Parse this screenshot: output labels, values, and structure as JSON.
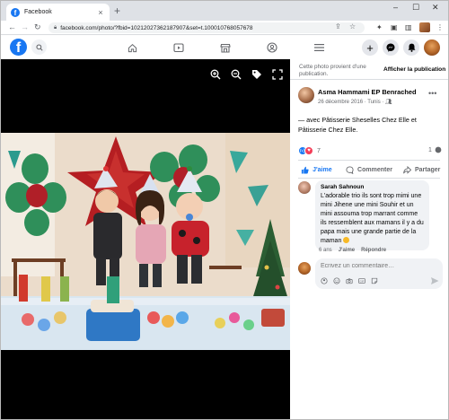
{
  "browser": {
    "tab_title": "Facebook",
    "tab_close": "×",
    "new_tab": "+",
    "url_host": "facebook.com",
    "url_path": "/photo/?fbid=10212027362187907&set=t.100010768057678",
    "window_controls": [
      "–",
      "☐",
      "✕"
    ]
  },
  "facebook_nav": {
    "logo": "f",
    "icons": [
      "home-icon",
      "watch-icon",
      "marketplace-icon",
      "groups-icon",
      "menu-icon"
    ],
    "right_icons": [
      "create-icon",
      "messenger-icon",
      "notifications-icon",
      "account-icon"
    ]
  },
  "viewer": {
    "tools": [
      "zoom-in-icon",
      "zoom-out-icon",
      "tag-icon",
      "fullscreen-icon"
    ],
    "photo_description_colors": {
      "balloon_green": "#2f8f5a",
      "star_red": "#b51e22"
    }
  },
  "panel": {
    "notice": [
      "Cette photo provient d'une",
      "publication."
    ],
    "notice_link": "Afficher la publication",
    "author": "Asma Hammami EP Benrached",
    "date": "26 décembre 2016 · Tunis ·",
    "caption": "— avec Pâtisserie Sheselles Chez Elle et Pâtisserie Chez Elle.",
    "reaction_count": "7",
    "comment_count": "1",
    "actions": {
      "like": "J'aime",
      "comment": "Commenter",
      "share": "Partager"
    },
    "comment": {
      "name": "Sarah Sahnoun",
      "text": "L'adorable trio ils sont trop mimi une mini Jihene une mini Souhir et un mini assouma trop marrant comme ils ressemblent aux mamans il y a du papa mais une grande partie de la maman",
      "age": "6 ans",
      "like": "J'aime",
      "reply": "Répondre"
    },
    "write_placeholder": "Écrivez un commentaire…"
  },
  "colors": {
    "brand": "#1877f2",
    "love": "#f33e58",
    "muted": "#65676b"
  }
}
